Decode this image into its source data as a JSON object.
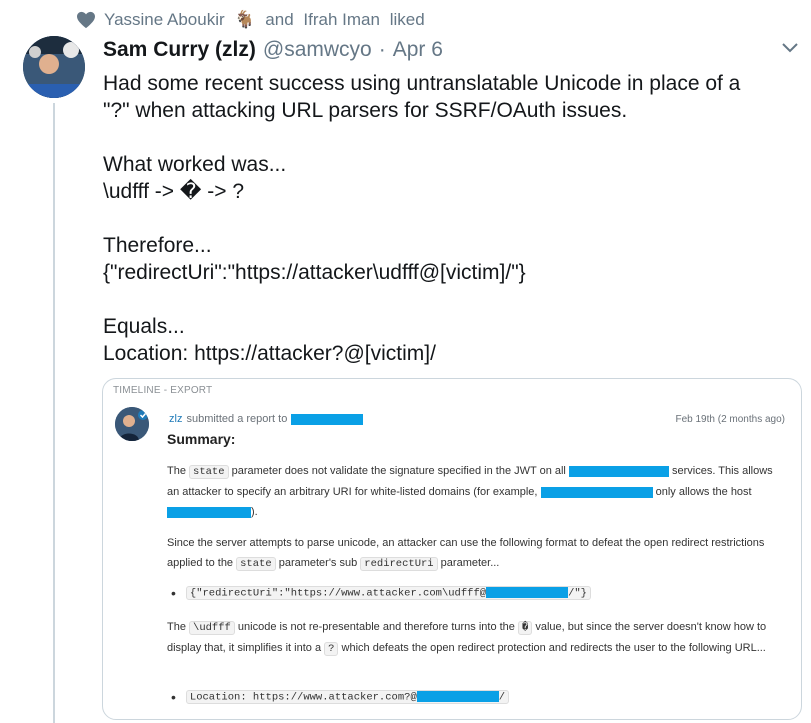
{
  "social_context": {
    "user1": "Yassine Aboukir",
    "goat_icon": "🐐",
    "conjunction": "and",
    "user2": "Ifrah Iman",
    "action": "liked"
  },
  "tweet": {
    "display_name": "Sam Curry (zlz)",
    "handle": "@samwcyo",
    "separator": "·",
    "date": "Apr 6",
    "text": "Had some recent success using untranslatable Unicode in place of a\n\"?\" when attacking URL parsers for SSRF/OAuth issues.\n\nWhat worked was...\n\\udfff -> � -> ?\n\nTherefore...\n{\"redirectUri\":\"https://attacker\\udfff@[victim]/\"}\n\nEquals...\nLocation: https://attacker?@[victim]/"
  },
  "report": {
    "section_label": "TIMELINE - EXPORT",
    "reporter": "zlz",
    "submitted_text": "submitted a report to",
    "report_date": "Feb 19th (2 months ago)",
    "summary_heading": "Summary:",
    "p1": {
      "a": "The",
      "code_state": "state",
      "b": "parameter does not validate the signature specified in the JWT on all",
      "c": "services. This allows an attacker to specify an arbitrary URI for white-listed domains (for example,",
      "d": "only allows the host",
      "e": ")."
    },
    "p2": {
      "a": "Since the server attempts to parse unicode, an attacker can use the following format to defeat the open redirect restrictions applied to the",
      "code_state": "state",
      "b": "parameter's sub",
      "code_redirect": "redirectUri",
      "c": "parameter..."
    },
    "bullet1": {
      "prefix": "{\"redirectUri\":\"https://www.attacker.com\\udfff@",
      "suffix": "/\"}"
    },
    "p3": {
      "a": "The",
      "code_udfff": "\\udfff",
      "b": "unicode is not re-presentable and therefore turns into the",
      "code_repl": "�",
      "c": "value, but since the server doesn't know how to display that, it simplifies it into a",
      "code_q": "?",
      "d": "which defeats the open redirect protection and redirects the user to the following URL..."
    },
    "bullet2": {
      "prefix": "Location: https://www.attacker.com?@",
      "suffix": "/"
    }
  },
  "colors": {
    "redaction": "#0aa0e6",
    "muted": "#657786",
    "link": "#1f7ab8"
  }
}
